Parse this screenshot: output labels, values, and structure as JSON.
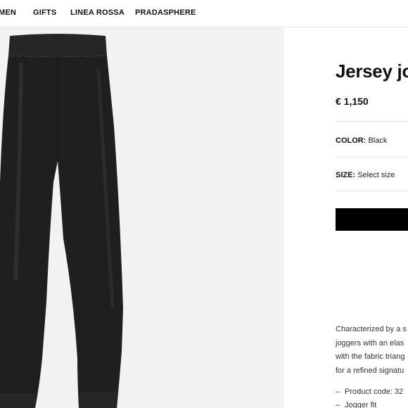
{
  "nav": {
    "items": [
      "MEN",
      "GIFTS",
      "LINEA ROSSA",
      "PRADASPHERE"
    ]
  },
  "product": {
    "title": "Jersey jo",
    "price": "€ 1,150",
    "color_label": "COLOR:",
    "color_value": "Black",
    "size_label": "SIZE:",
    "size_value": "Select size",
    "add_button_label": "",
    "description": [
      "Characterized by a s",
      "joggers with an elas",
      "with the fabric triang",
      "for a refined signatu"
    ],
    "details": [
      "Product code: 32",
      "Jogger fit"
    ],
    "product_color_hex": "#1c1c1c"
  },
  "colors": {
    "image_background": "#f2f2f2",
    "button": "#000000",
    "divider": "#e3e3e3"
  }
}
